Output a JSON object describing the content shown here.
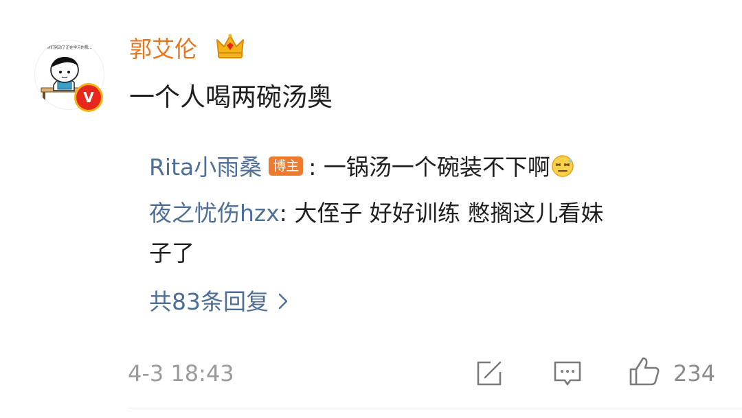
{
  "comment": {
    "username": "郭艾伦",
    "text": "一个人喝两碗汤奥",
    "avatar_caption": "你们别动了正在学习的我...",
    "verified_mark": "V",
    "timestamp": "4-3 18:43",
    "like_count": "234"
  },
  "replies": [
    {
      "user": "Rita小雨桑",
      "badge": "博主",
      "separator": ": ",
      "text": "一锅汤一个碗装不下啊"
    },
    {
      "user": "夜之忧伤hzx",
      "separator": ": ",
      "text_line1": "大侄子 好好训练 憋搁这儿看妹",
      "text_line2": "子了"
    }
  ],
  "more_replies_label": "共83条回复",
  "colors": {
    "username": "#e8761e",
    "reply_user": "#4d6e96",
    "badge_bg": "#f07a2c",
    "text": "#1e1e1e",
    "meta": "#9a9a9a"
  },
  "icons": {
    "crown": "crown-icon",
    "sweat_emoji": "sweat-emoji-icon",
    "share": "share-icon",
    "comment": "comment-icon",
    "like": "thumbs-up-icon",
    "chevron": "chevron-right-icon"
  }
}
